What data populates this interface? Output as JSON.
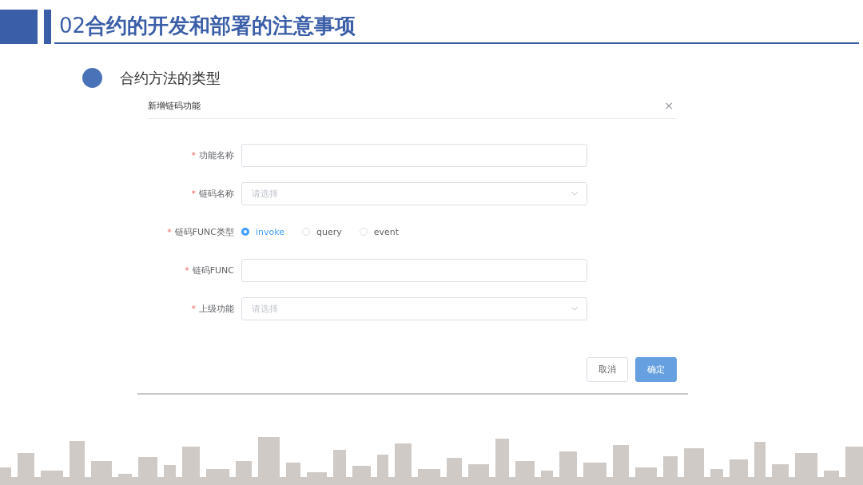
{
  "slide": {
    "title": "02**合约的开发和部署的注意事项**",
    "bullet": "合约方法的类型"
  },
  "dialog": {
    "title": "新增链码功能",
    "close": "×",
    "fields": [
      {
        "kind": "input",
        "label": "功能名称",
        "required_mark": "*"
      },
      {
        "kind": "select",
        "label": "链码名称",
        "required_mark": "*",
        "placeholder": "请选择"
      },
      {
        "kind": "radio",
        "label": "链码FUNC类型",
        "required_mark": "*",
        "options": [
          {
            "label": "invoke",
            "selected": true
          },
          {
            "label": "query",
            "selected": false
          },
          {
            "label": "event",
            "selected": false
          }
        ]
      },
      {
        "kind": "input",
        "label": "链码FUNC",
        "required_mark": "*"
      },
      {
        "kind": "select",
        "label": "上级功能",
        "required_mark": "*",
        "placeholder": "请选择"
      }
    ],
    "buttons": [
      {
        "label": "取消",
        "kind": "default"
      },
      {
        "label": "确定",
        "kind": "primary"
      }
    ]
  }
}
